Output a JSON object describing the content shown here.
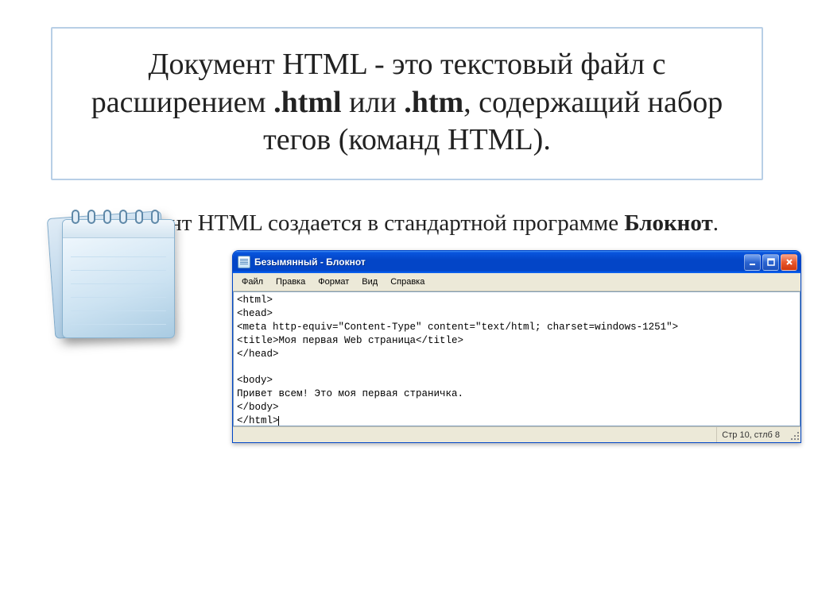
{
  "title": {
    "part1": "Документ HTML - это текстовый файл с расширением ",
    "bold1": ".html",
    "part2": " или ",
    "bold2": ".htm",
    "part3": ", содержащий набор тегов (команд HTML)."
  },
  "subtitle": {
    "part1": "Документ HTML создается в стандартной программе ",
    "bold": "Блокнот",
    "part2": "."
  },
  "notepad_window": {
    "title": "Безымянный - Блокнот",
    "menu": {
      "file": "Файл",
      "edit": "Правка",
      "format": "Формат",
      "view": "Вид",
      "help": "Справка"
    },
    "content": "<html>\n<head>\n<meta http-equiv=\"Content-Type\" content=\"text/html; charset=windows-1251\">\n<title>Моя первая Web страница</title>\n</head>\n\n<body>\nПривет всем! Это моя первая страничка.\n</body>\n</html>",
    "status": "Стр 10, стлб 8"
  }
}
